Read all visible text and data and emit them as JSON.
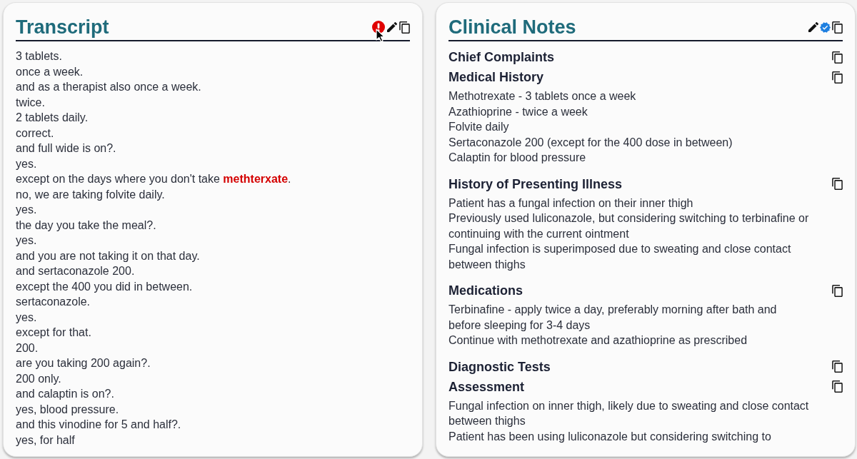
{
  "transcript": {
    "title": "Transcript",
    "alert": true,
    "lines": [
      "3 tablets.",
      "once a week.",
      "and as a therapist also once a week.",
      "twice.",
      "2 tablets daily.",
      "correct.",
      "and full wide is on?.",
      "yes.",
      "except on the days where you don't take **methterxate**.",
      "no, we are taking folvite daily.",
      "yes.",
      "the day you take the meal?.",
      "yes.",
      "and you are not taking it on that day.",
      "and sertaconazole 200.",
      "except the 400 you did in between.",
      "sertaconazole.",
      "yes.",
      "except for that.",
      "200.",
      "are you taking 200 again?.",
      "200 only.",
      "and calaptin is on?.",
      "yes, blood pressure.",
      "and this vinodine for 5 and half?.",
      "yes, for half"
    ]
  },
  "clinical_notes": {
    "title": "Clinical Notes",
    "verified": true,
    "sections": [
      {
        "heading": "Chief Complaints"
      },
      {
        "heading": "Medical History",
        "lines": [
          "Methotrexate - 3 tablets once a week",
          "Azathioprine - twice a week",
          "Folvite daily",
          "Sertaconazole 200 (except for the 400 dose in between)",
          "Calaptin for blood pressure"
        ]
      },
      {
        "heading": "History of Presenting Illness",
        "lines": [
          "Patient has a fungal infection on their inner thigh",
          "Previously used luliconazole, but considering switching to terbinafine or continuing with the current ointment",
          "Fungal infection is superimposed due to sweating and close contact between thighs"
        ]
      },
      {
        "heading": "Medications",
        "lines": [
          "Terbinafine - apply twice a day, preferably morning after bath and before sleeping for 3-4 days",
          "Continue with methotrexate and azathioprine as prescribed"
        ]
      },
      {
        "heading": "Diagnostic Tests"
      },
      {
        "heading": "Assessment",
        "lines": [
          "Fungal infection on inner thigh, likely due to sweating and close contact between thighs",
          "Patient has been using luliconazole but considering switching to"
        ]
      }
    ]
  }
}
